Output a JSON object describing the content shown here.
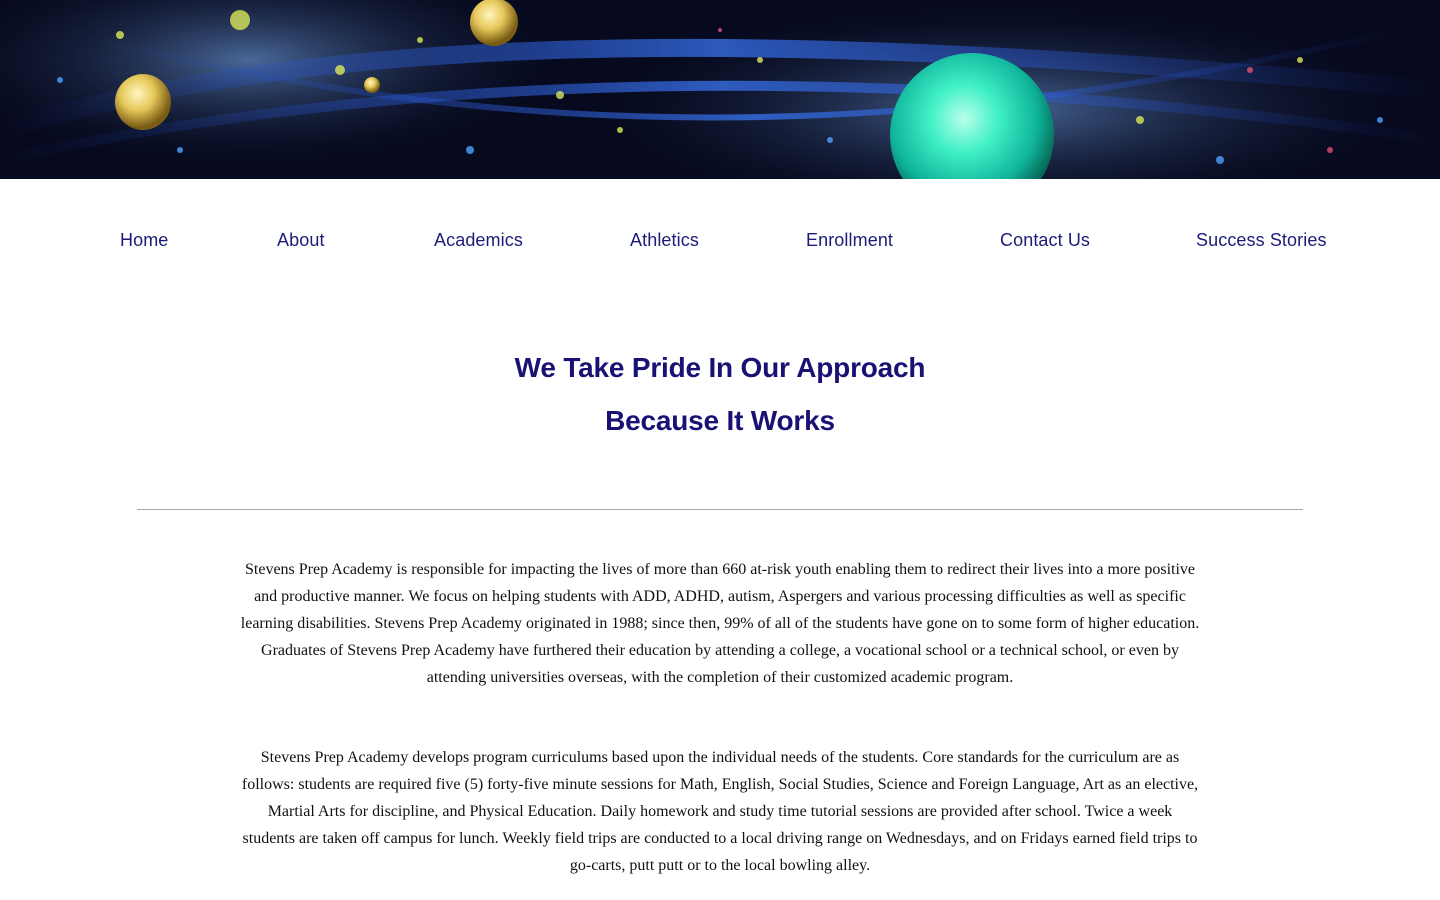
{
  "nav": {
    "items": [
      {
        "label": "Home"
      },
      {
        "label": "About"
      },
      {
        "label": "Academics"
      },
      {
        "label": "Athletics"
      },
      {
        "label": "Enrollment"
      },
      {
        "label": "Contact Us"
      },
      {
        "label": "Success Stories"
      }
    ]
  },
  "hero": {
    "heading_line1": "We Take Pride In Our Approach",
    "heading_line2": "Because It Works"
  },
  "content": {
    "paragraph1": "Stevens Prep Academy is responsible for impacting the lives of more than 660 at-risk youth enabling them to redirect their lives into a more positive and productive manner. We focus on helping students with ADD, ADHD, autism, Aspergers and various processing difficulties as well as specific learning disabilities. Stevens Prep Academy originated in 1988; since then, 99% of all of the students have gone on to some form of higher education. Graduates of Stevens Prep Academy have furthered their education by attending a college, a vocational school or a technical school, or even by attending universities overseas, with the completion of their customized academic program.",
    "paragraph2": "Stevens Prep Academy develops program curriculums based upon the individual needs of the students. Core standards for the curriculum are as follows: students are required five (5) forty-five minute sessions for Math, English, Social Studies, Science and Foreign Language, Art as an elective, Martial Arts for discipline, and Physical Education. Daily homework and study time tutorial sessions are provided after school. Twice a week students are taken off campus for lunch. Weekly field trips are conducted to a local driving range on Wednesdays, and on Fridays earned field trips to go-carts, putt putt or to the local bowling alley."
  },
  "colors": {
    "nav_text": "#1c1c78",
    "heading_text": "#1a1175",
    "body_text": "#111111",
    "divider": "#a8a8a8"
  }
}
